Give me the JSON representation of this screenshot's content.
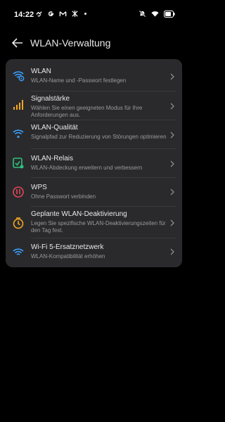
{
  "status": {
    "time": "14:22"
  },
  "header": {
    "title": "WLAN-Verwaltung"
  },
  "items": [
    {
      "title": "WLAN",
      "subtitle": "WLAN-Name und -Passwort festlegen",
      "icon": "wifi-settings-icon",
      "color": "#3aa0ff"
    },
    {
      "title": "Signalstärke",
      "subtitle": "Wählen Sie einen geeigneten Modus für Ihre Anforderungen aus.",
      "icon": "signal-bars-icon",
      "color": "#f5a623"
    },
    {
      "title": "WLAN-Qualität",
      "subtitle": "Signalpfad zur Reduzierung von Störungen optimieren",
      "icon": "wifi-quality-icon",
      "color": "#3aa0ff"
    },
    {
      "title": "WLAN-Relais",
      "subtitle": "WLAN-Abdeckung erweitern und verbessern",
      "icon": "relay-icon",
      "color": "#2ec27e"
    },
    {
      "title": "WPS",
      "subtitle": "Ohne Passwort verbinden",
      "icon": "wps-icon",
      "color": "#e0475a"
    },
    {
      "title": "Geplante WLAN-Deaktivierung",
      "subtitle": "Legen Sie spezifische WLAN-Deaktivierungszeiten für den Tag fest.",
      "icon": "timer-icon",
      "color": "#f5a623"
    },
    {
      "title": "Wi-Fi 5-Ersatznetzwerk",
      "subtitle": "WLAN-Kompatibilität erhöhen",
      "icon": "wifi5-icon",
      "color": "#3aa0ff"
    }
  ]
}
